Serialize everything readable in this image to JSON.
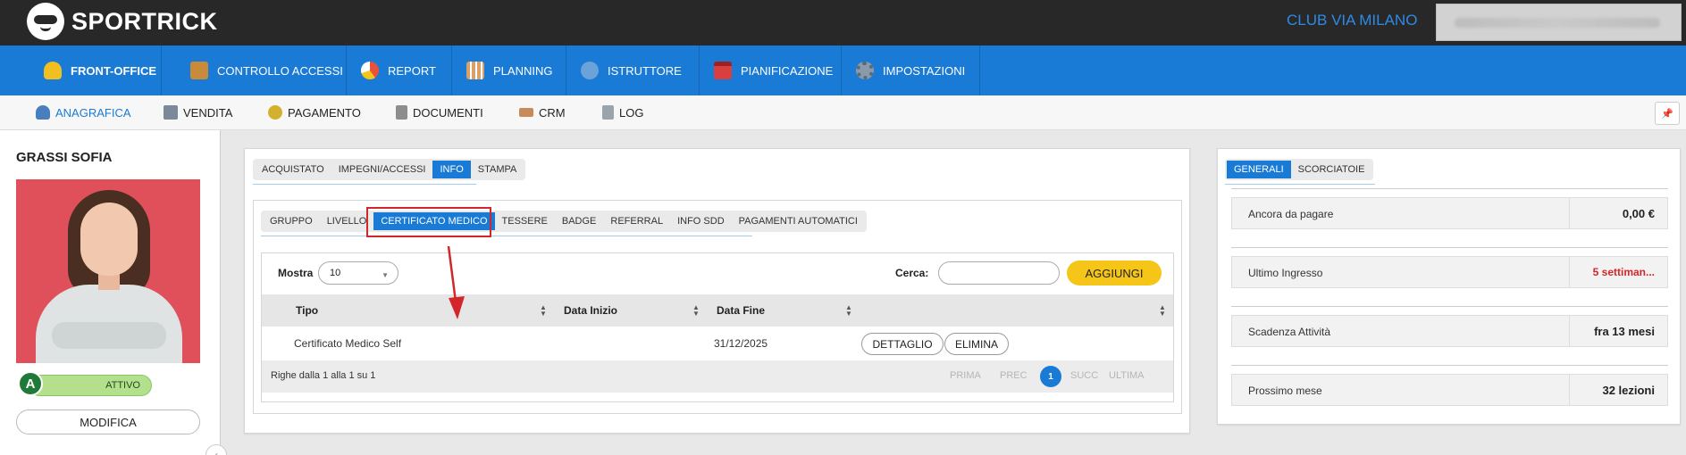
{
  "app": {
    "name": "SPORTRICK",
    "club": "CLUB VIA MILANO"
  },
  "main_nav": [
    {
      "label": "FRONT-OFFICE",
      "icon": "person-icon",
      "color": "#f0c020"
    },
    {
      "label": "CONTROLLO ACCESSI",
      "icon": "turnstile-icon",
      "color": "#c98a3a"
    },
    {
      "label": "REPORT",
      "icon": "pie-chart-icon",
      "color": "#e8523a"
    },
    {
      "label": "PLANNING",
      "icon": "calendar-grid-icon",
      "color": "#d9a06a"
    },
    {
      "label": "ISTRUTTORE",
      "icon": "instructors-icon",
      "color": "#6aa2d9"
    },
    {
      "label": "PIANIFICAZIONE",
      "icon": "calendar-icon",
      "color": "#d84040"
    },
    {
      "label": "IMPOSTAZIONI",
      "icon": "gear-icon",
      "color": "#8a9aa8"
    }
  ],
  "sub_nav": [
    {
      "label": "ANAGRAFICA",
      "icon": "user-icon",
      "color": "#4a7fbf"
    },
    {
      "label": "VENDITA",
      "icon": "cash-register-icon",
      "color": "#7a8a99"
    },
    {
      "label": "PAGAMENTO",
      "icon": "coin-icon",
      "color": "#d4b030"
    },
    {
      "label": "DOCUMENTI",
      "icon": "document-icon",
      "color": "#8d8d8d"
    },
    {
      "label": "CRM",
      "icon": "handshake-icon",
      "color": "#c98a5a"
    },
    {
      "label": "LOG",
      "icon": "log-icon",
      "color": "#9aa4ad"
    }
  ],
  "pin_icon": "📌",
  "profile": {
    "name": "GRASSI SOFIA",
    "status_letter": "A",
    "status_text": "ATTIVO",
    "edit_label": "MODIFICA",
    "collapse_glyph": "‹"
  },
  "center": {
    "top_tabs": [
      "ACQUISTATO",
      "IMPEGNI/ACCESSI",
      "INFO",
      "STAMPA"
    ],
    "info_tabs": [
      "GRUPPO",
      "LIVELLO",
      "CERTIFICATO MEDICO",
      "TESSERE",
      "BADGE",
      "REFERRAL",
      "INFO SDD",
      "PAGAMENTI AUTOMATICI"
    ],
    "show_label": "Mostra",
    "show_value": "10",
    "search_label": "Cerca:",
    "search_value": "",
    "add_label": "AGGIUNGI",
    "columns": [
      "Tipo",
      "Data Inizio",
      "Data Fine"
    ],
    "rows": [
      {
        "tipo": "Certificato Medico Self",
        "data_inizio": "",
        "data_fine": "31/12/2025",
        "actions": [
          "DETTAGLIO",
          "ELIMINA"
        ]
      }
    ],
    "footer_text": "Righe dalla 1 alla 1 su 1",
    "pagination": {
      "first": "PRIMA",
      "prev": "PREC",
      "current": "1",
      "next": "SUCC",
      "last": "ULTIMA"
    }
  },
  "right": {
    "tabs": [
      "GENERALI",
      "SCORCIATOIE"
    ],
    "stats": [
      {
        "label": "Ancora da pagare",
        "value": "0,00 €"
      },
      {
        "label": "Ultimo Ingresso",
        "value": "5 settiman...",
        "color": "#d3262a"
      },
      {
        "label": "Scadenza Attività",
        "value": "fra 13 mesi"
      },
      {
        "label": "Prossimo mese",
        "value": "32 lezioni"
      }
    ]
  },
  "colors": {
    "primary": "#1a7bd6",
    "accent": "#f5c518",
    "annotation": "#d3262a",
    "status": "#b4e08e"
  }
}
